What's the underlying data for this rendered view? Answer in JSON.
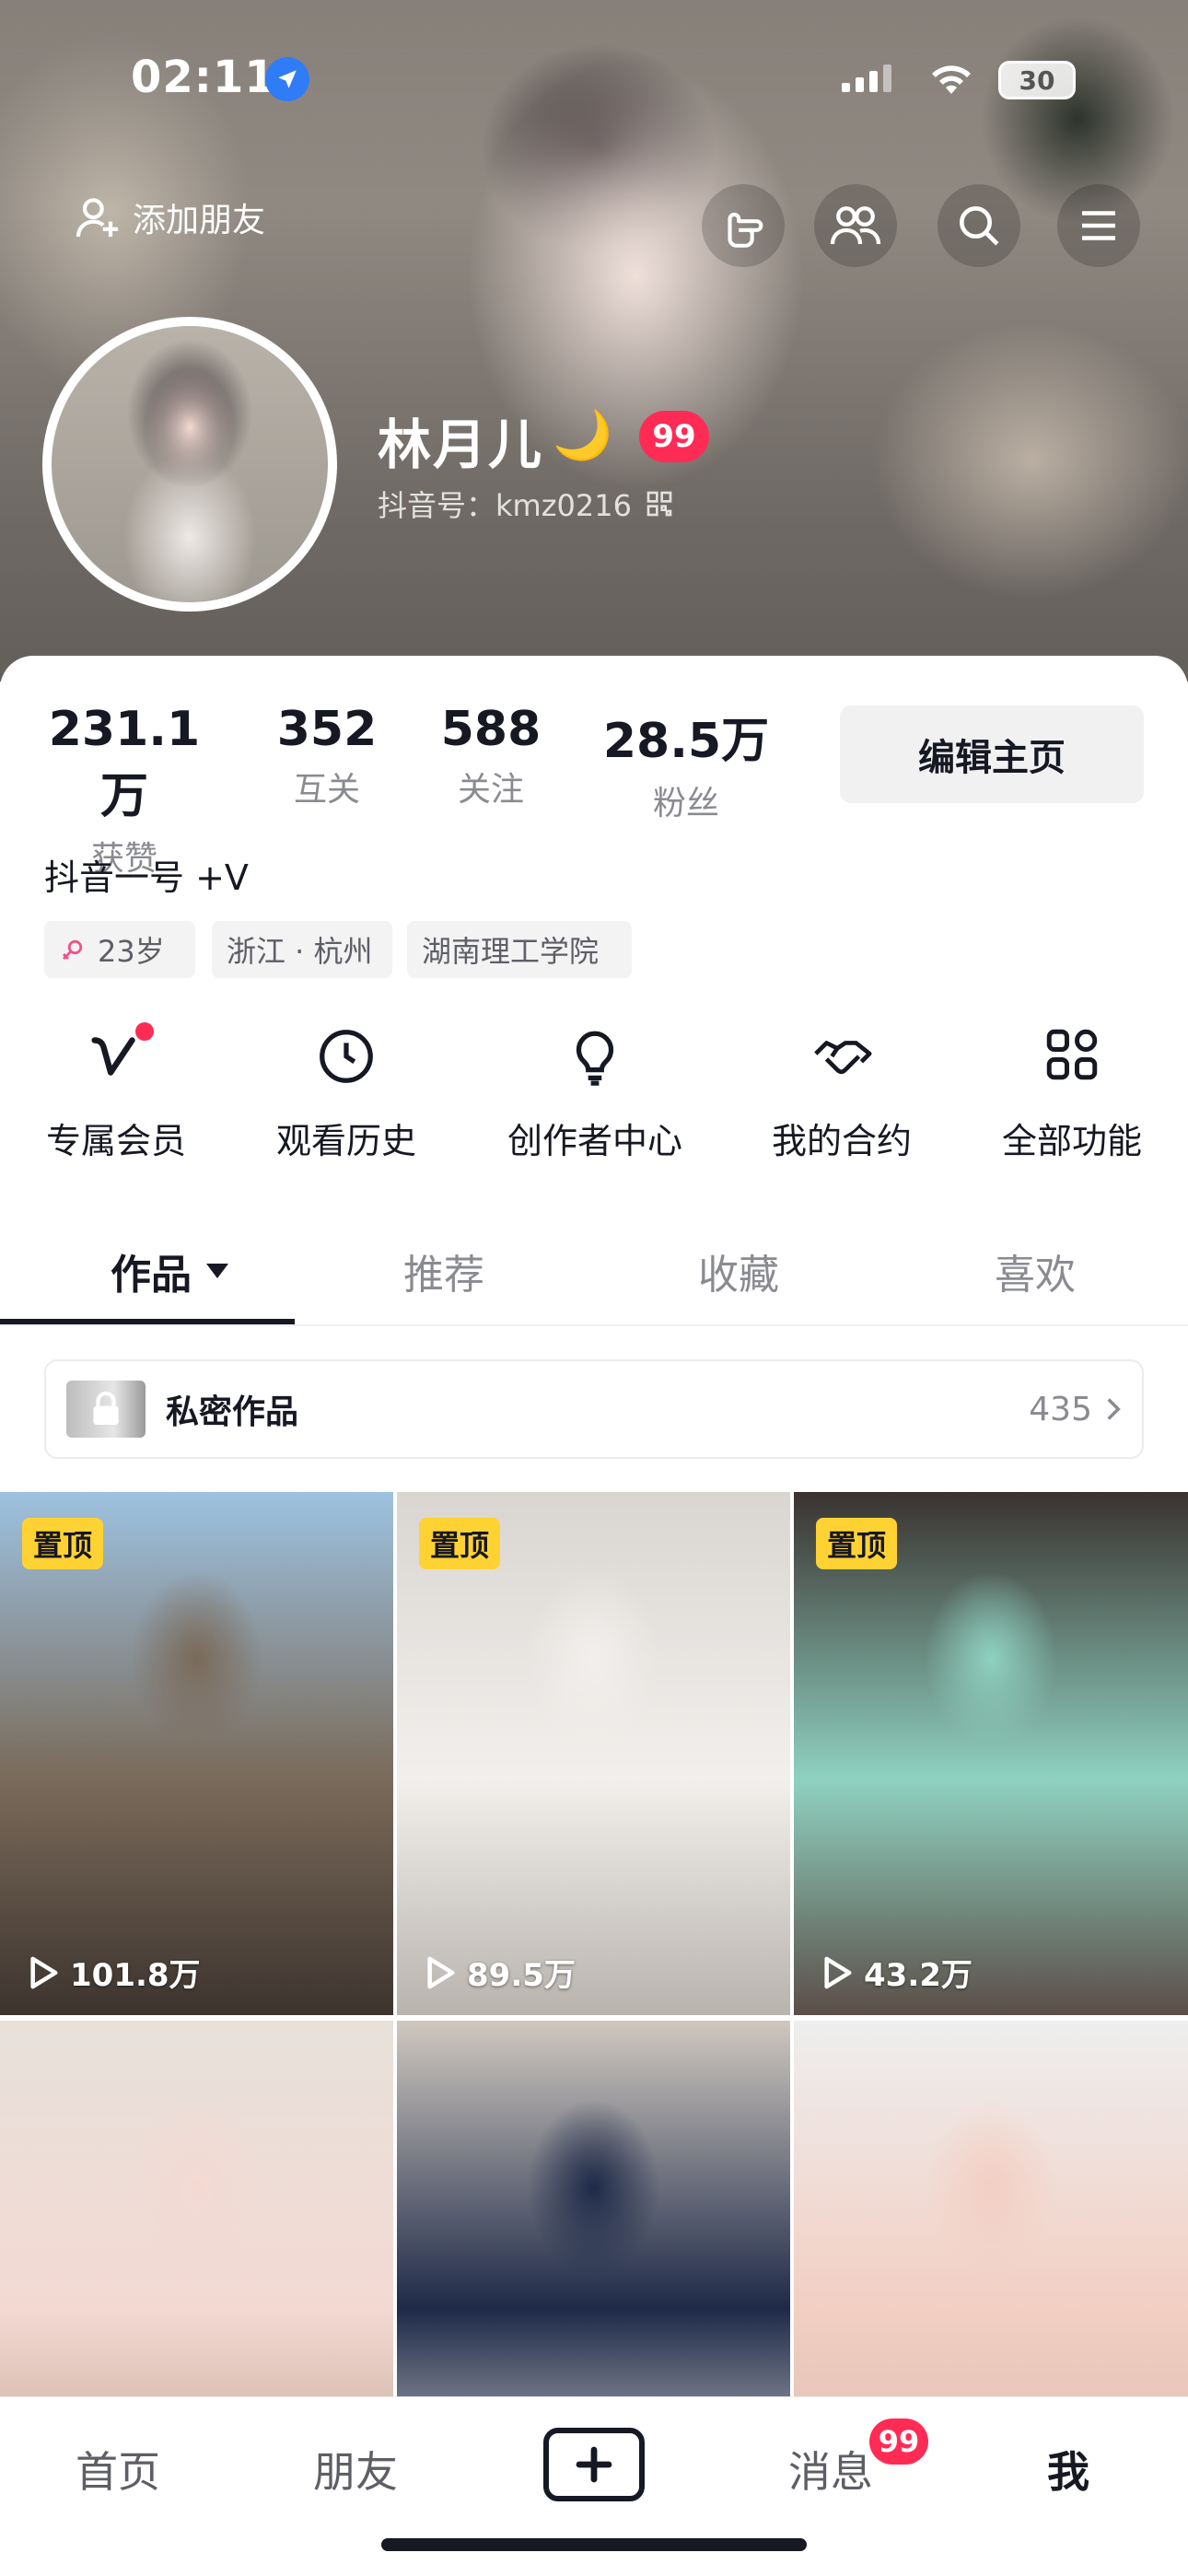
{
  "status_bar": {
    "time": "02:11",
    "battery": "30"
  },
  "header": {
    "add_friend": "添加朋友",
    "icons": [
      "hand-point-icon",
      "friends-icon",
      "search-icon",
      "menu-icon"
    ]
  },
  "profile": {
    "nickname": "林月儿",
    "nickname_emoji": "🌙",
    "level_badge": "99",
    "douyin_id": "抖音号：kmz0216"
  },
  "stats": [
    {
      "value": "231.1万",
      "label": "获赞"
    },
    {
      "value": "352",
      "label": "互关"
    },
    {
      "value": "588",
      "label": "关注"
    },
    {
      "value": "28.5万",
      "label": "粉丝"
    }
  ],
  "edit_button": "编辑主页",
  "bio": "抖音一号 +V",
  "tags": [
    "23岁",
    "浙江 · 杭州",
    "湖南理工学院"
  ],
  "functions": [
    {
      "label": "专属会员",
      "icon": "vip-v-icon"
    },
    {
      "label": "观看历史",
      "icon": "clock-icon"
    },
    {
      "label": "创作者中心",
      "icon": "lightbulb-icon"
    },
    {
      "label": "我的合约",
      "icon": "handshake-icon"
    },
    {
      "label": "全部功能",
      "icon": "grid-icon"
    }
  ],
  "tabs": [
    "作品",
    "推荐",
    "收藏",
    "喜欢"
  ],
  "private_works": {
    "label": "私密作品",
    "count": "435"
  },
  "videos": [
    {
      "pinned": "置顶",
      "plays": "101.8万",
      "colors": [
        "#9dc2e0",
        "#7a6a5a",
        "#3d342e"
      ]
    },
    {
      "pinned": "置顶",
      "plays": "89.5万",
      "colors": [
        "#d9d6d2",
        "#f2efec",
        "#b8b3ad"
      ]
    },
    {
      "pinned": "置顶",
      "plays": "43.2万",
      "colors": [
        "#3a3230",
        "#8fd1c0",
        "#5b4e48"
      ]
    },
    {
      "pinned": "",
      "plays": "",
      "colors": [
        "#e7e1da",
        "#f4d9d3",
        "#b49c86"
      ]
    },
    {
      "pinned": "",
      "plays": "",
      "colors": [
        "#cfc8c0",
        "#1e2a48",
        "#efece8"
      ]
    },
    {
      "pinned": "",
      "plays": "",
      "colors": [
        "#eeeeee",
        "#f3cfc3",
        "#d9b8ac"
      ]
    }
  ],
  "bottom_nav": {
    "home": "首页",
    "friends": "朋友",
    "messages": "消息",
    "messages_badge": "99",
    "me": "我"
  },
  "colors": {
    "accent": "#fe2c55",
    "pin": "#ffd234"
  }
}
